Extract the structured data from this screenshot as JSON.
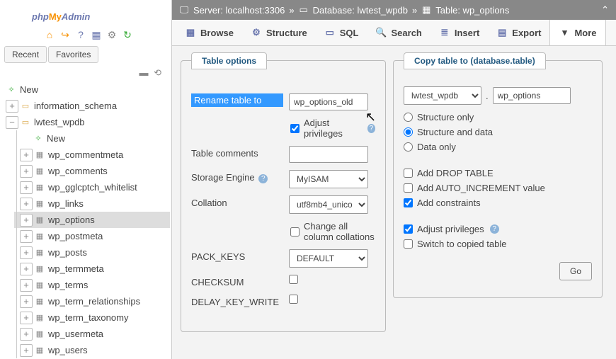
{
  "logo": {
    "php": "php",
    "my": "My",
    "admin": "Admin"
  },
  "sideTabs": {
    "recent": "Recent",
    "favorites": "Favorites"
  },
  "tree": {
    "new": "New",
    "db1": "information_schema",
    "db2": "lwtest_wpdb",
    "db2_new": "New",
    "tables": [
      "wp_commentmeta",
      "wp_comments",
      "wp_gglcptch_whitelist",
      "wp_links",
      "wp_options",
      "wp_postmeta",
      "wp_posts",
      "wp_termmeta",
      "wp_terms",
      "wp_term_relationships",
      "wp_term_taxonomy",
      "wp_usermeta",
      "wp_users"
    ],
    "selected": "wp_options"
  },
  "breadcrumb": {
    "server": "Server: localhost:3306",
    "db": "Database: lwtest_wpdb",
    "table": "Table: wp_options",
    "sep": "»"
  },
  "toolbar": {
    "browse": "Browse",
    "structure": "Structure",
    "sql": "SQL",
    "search": "Search",
    "insert": "Insert",
    "export": "Export",
    "more": "More"
  },
  "leftPanel": {
    "title": "Table options",
    "rename_label": "Rename table to",
    "rename_value": "wp_options_old",
    "adjust": "Adjust privileges",
    "comments_label": "Table comments",
    "comments_value": "",
    "engine_label": "Storage Engine",
    "engine_value": "MyISAM",
    "collation_label": "Collation",
    "collation_value": "utf8mb4_unico",
    "change_coll": "Change all column collations",
    "pack_label": "PACK_KEYS",
    "pack_value": "DEFAULT",
    "checksum_label": "CHECKSUM",
    "delay_label": "DELAY_KEY_WRITE"
  },
  "rightPanel": {
    "title": "Copy table to (database.table)",
    "db_value": "lwtest_wpdb",
    "dot": ".",
    "table_value": "wp_options",
    "structure_only": "Structure only",
    "structure_data": "Structure and data",
    "data_only": "Data only",
    "drop": "Add DROP TABLE",
    "auto": "Add AUTO_INCREMENT value",
    "constraints": "Add constraints",
    "adjust": "Adjust privileges",
    "switch": "Switch to copied table",
    "go": "Go"
  }
}
